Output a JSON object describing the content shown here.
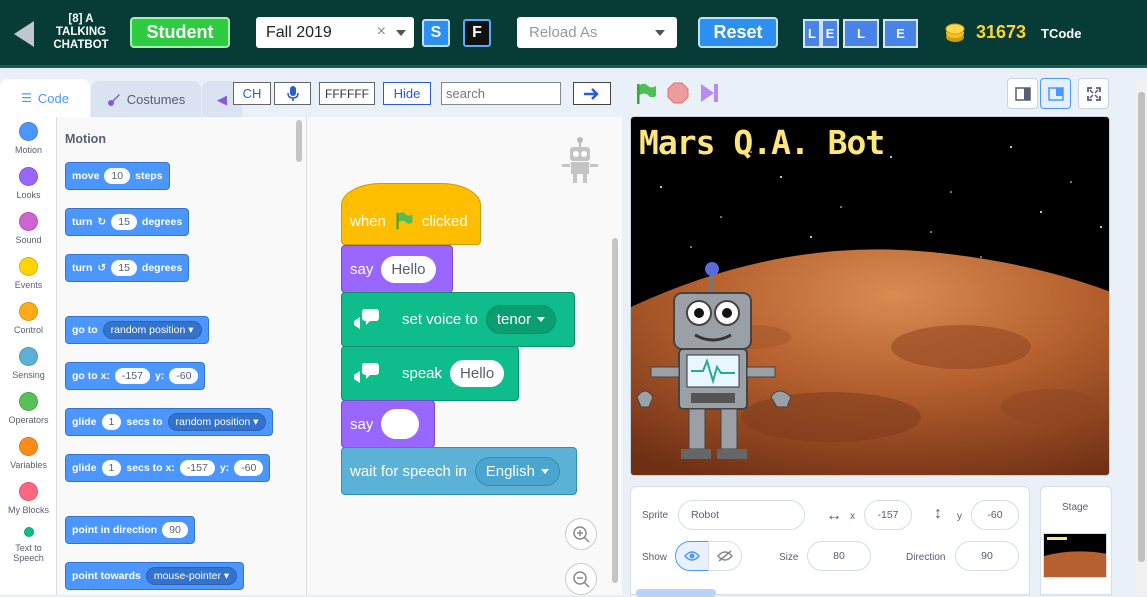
{
  "topbar": {
    "lesson_title_line1": "[8] A",
    "lesson_title_line2": "TALKING",
    "lesson_title_line3": "CHATBOT",
    "role_label": "Student",
    "term_value": "Fall 2019",
    "term_clear": "×",
    "s_label": "S",
    "f_label": "F",
    "reload_placeholder": "Reload As",
    "reset_label": "Reset",
    "lele": [
      "L",
      "E",
      "L",
      "E"
    ],
    "coins": "31673",
    "coin_unit": "TCode"
  },
  "tabs": {
    "code": "Code",
    "costumes": "Costumes"
  },
  "tools": {
    "ch": "CH",
    "color": "FFFFFF",
    "hide": "Hide",
    "search_placeholder": "search",
    "go": "➡"
  },
  "categories": [
    {
      "label": "Motion",
      "color": "#4c97ff"
    },
    {
      "label": "Looks",
      "color": "#9966ff"
    },
    {
      "label": "Sound",
      "color": "#cf63cf"
    },
    {
      "label": "Events",
      "color": "#ffd500"
    },
    {
      "label": "Control",
      "color": "#ffab19"
    },
    {
      "label": "Sensing",
      "color": "#5cb1d6"
    },
    {
      "label": "Operators",
      "color": "#59c059"
    },
    {
      "label": "Variables",
      "color": "#ff8c1a"
    },
    {
      "label": "My Blocks",
      "color": "#ff6680"
    },
    {
      "label": "Text to",
      "label2": "Speech",
      "color": "#0fbd8c"
    }
  ],
  "palette": {
    "title": "Motion",
    "move": {
      "a": "move",
      "v": "10",
      "b": "steps"
    },
    "turn_r": {
      "a": "turn",
      "v": "15",
      "b": "degrees"
    },
    "turn_l": {
      "a": "turn",
      "v": "15",
      "b": "degrees"
    },
    "goto": {
      "a": "go to",
      "dd": "random position"
    },
    "gotoxy": {
      "a": "go to x:",
      "x": "-157",
      "b": "y:",
      "y": "-60"
    },
    "glide1": {
      "a": "glide",
      "v": "1",
      "b": "secs to",
      "dd": "random position"
    },
    "glide2": {
      "a": "glide",
      "v": "1",
      "b": "secs to x:",
      "x": "-157",
      "c": "y:",
      "y": "-60"
    },
    "point_dir": {
      "a": "point in direction",
      "v": "90"
    },
    "point_towards": {
      "a": "point towards",
      "dd": "mouse-pointer"
    }
  },
  "script": {
    "when": "when",
    "clicked": "clicked",
    "say1": "say",
    "say1_value": "Hello",
    "voice": "set voice to",
    "voice_value": "tenor",
    "speak": "speak",
    "speak_value": "Hello",
    "say2": "say",
    "say2_value": "",
    "wait": "wait for speech in",
    "wait_value": "English"
  },
  "stage": {
    "title": "Mars Q.A. Bot"
  },
  "sprite_info": {
    "sprite_label": "Sprite",
    "sprite_name": "Robot",
    "x_label": "x",
    "x": "-157",
    "y_label": "y",
    "y": "-60",
    "show_label": "Show",
    "size_label": "Size",
    "size": "80",
    "direction_label": "Direction",
    "direction": "90"
  },
  "stage_panel": {
    "label": "Stage"
  }
}
